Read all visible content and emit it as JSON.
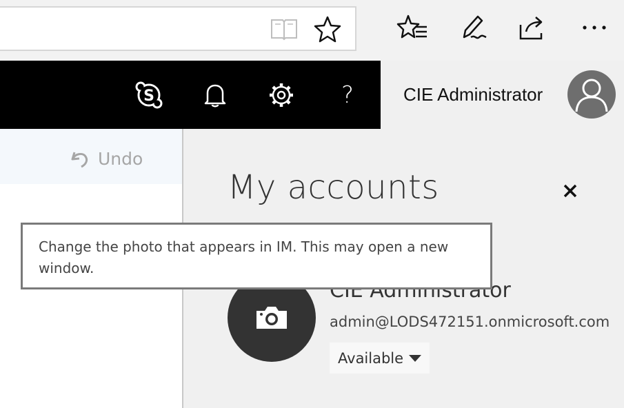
{
  "browser": {
    "icons": [
      "reading-view-icon",
      "favorite-star-icon",
      "favorites-hub-icon",
      "web-note-pen-icon",
      "share-icon",
      "more-icon"
    ]
  },
  "header": {
    "user_name": "CIE Administrator",
    "icons": [
      "skype-icon",
      "bell-icon",
      "gear-icon",
      "help-icon"
    ],
    "help_glyph": "?"
  },
  "toolbar": {
    "undo_label": "Undo"
  },
  "panel": {
    "title": "My accounts",
    "account_name": "CIE Administrator",
    "email": "admin@LODS472151.onmicrosoft.com",
    "status": "Available"
  },
  "tooltip": {
    "text": "Change the photo that appears in IM. This may open a new window."
  },
  "colors": {
    "header_bg": "#000000",
    "panel_bg": "#f0f0f0",
    "photo_circle": "#333333",
    "avatar_bg": "#6e6e6e"
  }
}
